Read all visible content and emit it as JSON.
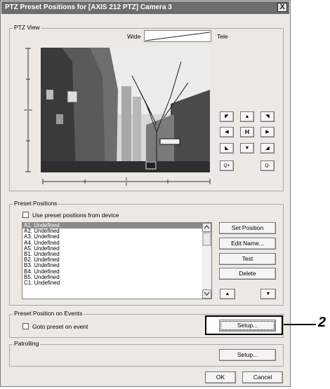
{
  "window": {
    "title": "PTZ Preset Positions for [AXIS 212 PTZ] Camera 3",
    "close_label": "X"
  },
  "ptz_view": {
    "group_label": "PTZ View",
    "zoom_wide_label": "Wide",
    "zoom_tele_label": "Tele",
    "home_label": "H",
    "zoom_in_label": "Q+",
    "zoom_out_label": "Q-"
  },
  "preset_positions": {
    "group_label": "Preset Positions",
    "use_device_label": "Use preset positions from device",
    "items": [
      "A1. Undefined",
      "A2. Undefined",
      "A3. Undefined",
      "A4. Undefined",
      "A5. Undefined",
      "B1. Undefined",
      "B2. Undefined",
      "B3. Undefined",
      "B4. Undefined",
      "B5. Undefined",
      "C1. Undefined"
    ],
    "selected_index": 0,
    "set_position_label": "Set Position",
    "edit_name_label": "Edit Name...",
    "test_label": "Test",
    "delete_label": "Delete"
  },
  "events": {
    "group_label": "Preset Position on Events",
    "goto_label": "Goto preset on event",
    "setup_label": "Setup..."
  },
  "patrolling": {
    "group_label": "Patrolling",
    "setup_label": "Setup..."
  },
  "footer": {
    "ok_label": "OK",
    "cancel_label": "Cancel"
  },
  "callout": {
    "label": "2"
  }
}
